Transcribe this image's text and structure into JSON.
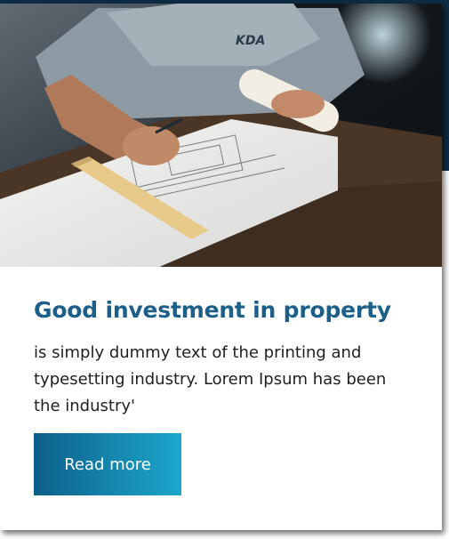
{
  "card": {
    "image_alt": "Man drawing architectural blueprints with a ruler",
    "shirt_logo": "KDA",
    "title": "Good investment in property",
    "text": "is simply dummy text of the printing and typesetting industry. Lorem Ipsum has been the industry'",
    "button_label": "Read more"
  },
  "colors": {
    "title": "#1b5f8a",
    "button_start": "#0d5f8a",
    "button_end": "#1ca7cc",
    "backdrop": "#0f2c45"
  }
}
